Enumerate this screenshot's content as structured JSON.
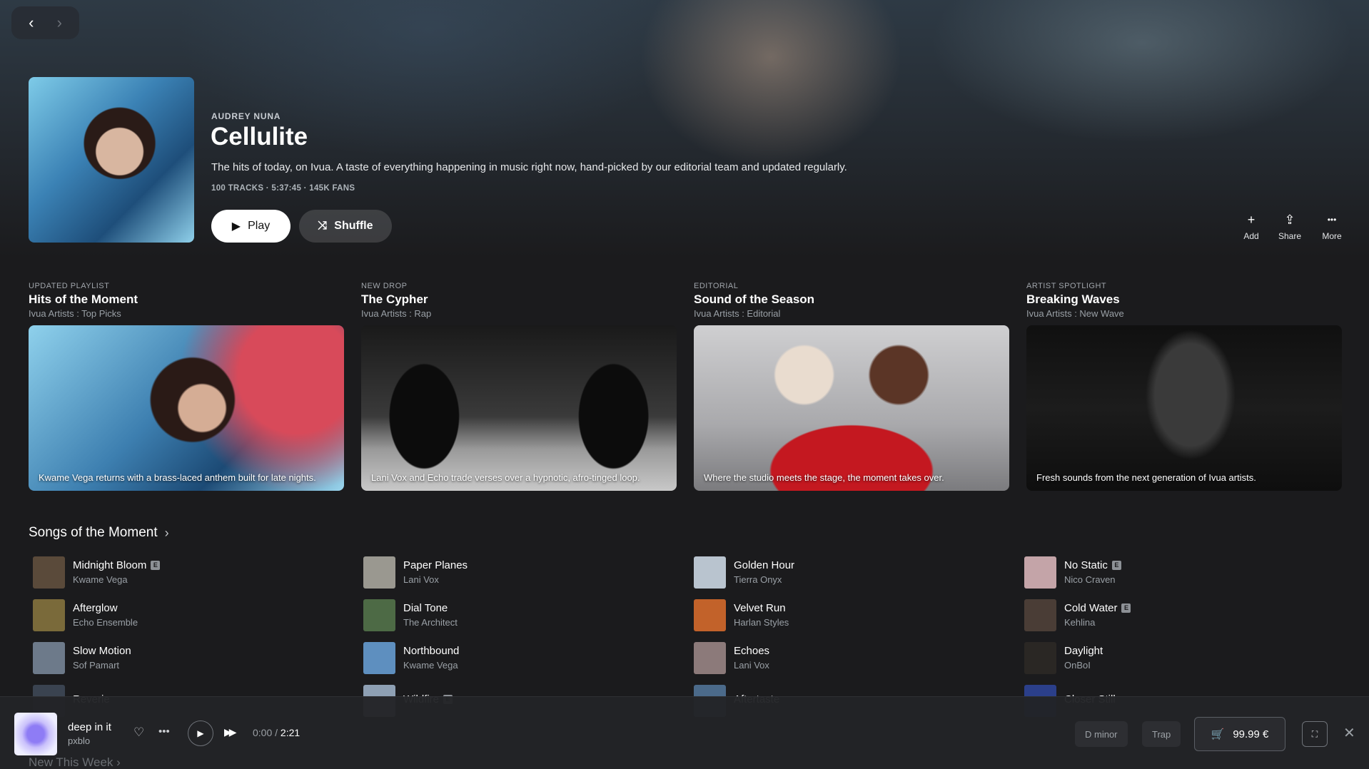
{
  "hero": {
    "artist": "AUDREY NUNA",
    "title": "Cellulite",
    "description": "The hits of today, on Ivua. A taste of everything happening in music right now, hand-picked by our editorial team and updated regularly.",
    "meta": "100 TRACKS · 5:37:45 · 145K FANS",
    "play_label": "Play",
    "shuffle_label": "Shuffle"
  },
  "nav": {
    "back": "‹",
    "forward": "›"
  },
  "actions": [
    {
      "icon": "plus-icon",
      "glyph": "+",
      "label": "Add"
    },
    {
      "icon": "share-icon",
      "glyph": "⇪",
      "label": "Share"
    },
    {
      "icon": "more-icon",
      "glyph": "•••",
      "label": "More"
    }
  ],
  "cards": [
    {
      "eyebrow": "UPDATED PLAYLIST",
      "title": "Hits of the Moment",
      "subtitle": "Ivua Artists : Top Picks",
      "caption": "Kwame Vega returns with a brass-laced anthem built for late nights."
    },
    {
      "eyebrow": "NEW DROP",
      "title": "The Cypher",
      "subtitle": "Ivua Artists : Rap",
      "caption": "Lani Vox and Echo trade verses over a hypnotic, afro-tinged loop."
    },
    {
      "eyebrow": "EDITORIAL",
      "title": "Sound of the Season",
      "subtitle": "Ivua Artists : Editorial",
      "caption": "Where the studio meets the stage, the moment takes over."
    },
    {
      "eyebrow": "ARTIST SPOTLIGHT",
      "title": "Breaking Waves",
      "subtitle": "Ivua Artists : New Wave",
      "caption": "Fresh sounds from the next generation of Ivua artists."
    }
  ],
  "songs_section": {
    "title": "Songs of the Moment",
    "chevron": "›"
  },
  "songs": [
    [
      {
        "title": "Midnight Bloom",
        "artist": "Kwame Vega",
        "explicit": true,
        "color": "#5a4a3a"
      },
      {
        "title": "Afterglow",
        "artist": "Echo Ensemble",
        "explicit": false,
        "color": "#7a6a3a"
      },
      {
        "title": "Slow Motion",
        "artist": "Sof Pamart",
        "explicit": false,
        "color": "#6d7a8a"
      },
      {
        "title": "Reverie",
        "artist": "",
        "explicit": false,
        "color": "#3a4350"
      }
    ],
    [
      {
        "title": "Paper Planes",
        "artist": "Lani Vox",
        "explicit": false,
        "color": "#9a9890"
      },
      {
        "title": "Dial Tone",
        "artist": "The Architect",
        "explicit": false,
        "color": "#4d6a45"
      },
      {
        "title": "Northbound",
        "artist": "Kwame Vega",
        "explicit": false,
        "color": "#5e8fbf"
      },
      {
        "title": "Wildfire",
        "artist": "",
        "explicit": true,
        "color": "#8ea0b4"
      }
    ],
    [
      {
        "title": "Golden Hour",
        "artist": "Tierra Onyx",
        "explicit": false,
        "color": "#b9c4cf"
      },
      {
        "title": "Velvet Run",
        "artist": "Harlan Styles",
        "explicit": false,
        "color": "#c2622a"
      },
      {
        "title": "Echoes",
        "artist": "Lani Vox",
        "explicit": false,
        "color": "#8c7a7a"
      },
      {
        "title": "Aftertaste",
        "artist": "",
        "explicit": false,
        "color": "#4b6a8a"
      }
    ],
    [
      {
        "title": "No Static",
        "artist": "Nico Craven",
        "explicit": true,
        "color": "#c4a4a8"
      },
      {
        "title": "Cold Water",
        "artist": "Kehlina",
        "explicit": true,
        "color": "#4a3d36"
      },
      {
        "title": "Daylight",
        "artist": "OnBoI",
        "explicit": false,
        "color": "#2a2724"
      },
      {
        "title": "Closer Still",
        "artist": "",
        "explicit": false,
        "color": "#2b3f8a"
      }
    ]
  ],
  "player": {
    "title": "deep in it",
    "artist": "pxblo",
    "time_current": "0:00",
    "time_total": "2:21",
    "key": "D minor",
    "genre": "Trap",
    "price": "99.99 €"
  },
  "footer_section": {
    "title": "New This Week",
    "chevron": "›"
  }
}
